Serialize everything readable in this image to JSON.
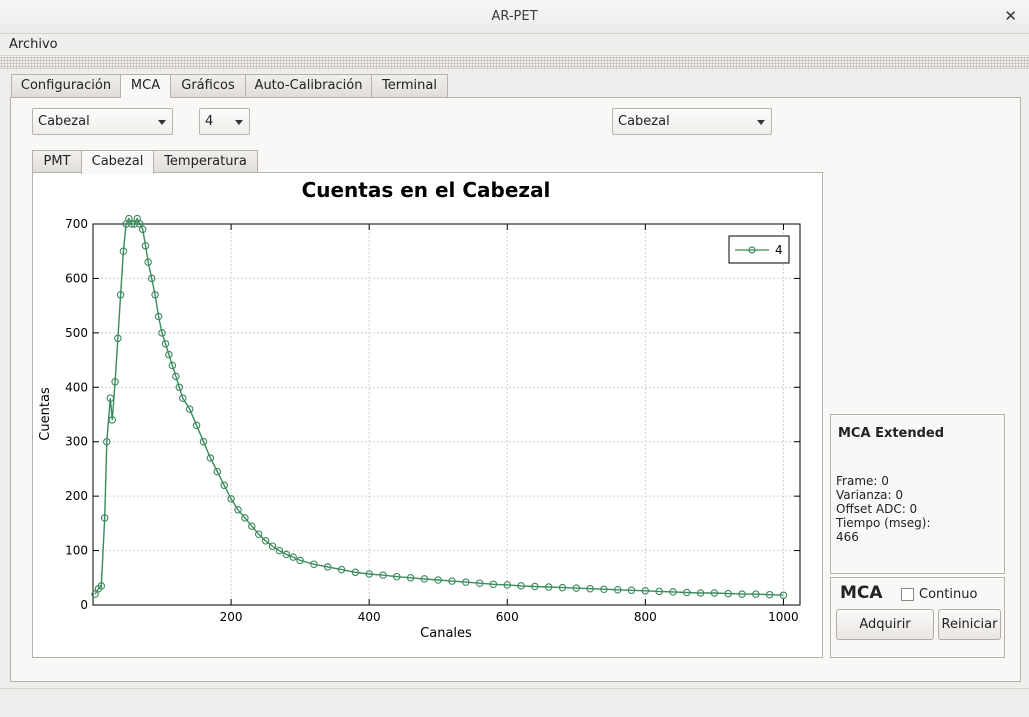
{
  "window": {
    "title": "AR-PET",
    "close_glyph": "✕"
  },
  "menubar": {
    "items": [
      "Archivo"
    ]
  },
  "main_tabs": [
    "Configuración",
    "MCA",
    "Gráficos",
    "Auto-Calibración",
    "Terminal"
  ],
  "controls": {
    "combo_left": "Cabezal",
    "combo_num": "4",
    "combo_right": "Cabezal"
  },
  "sub_tabs": [
    "PMT",
    "Cabezal",
    "Temperatura"
  ],
  "chart_data": {
    "type": "line",
    "title": "Cuentas en el Cabezal",
    "xlabel": "Canales",
    "ylabel": "Cuentas",
    "xlim": [
      0,
      1024
    ],
    "ylim": [
      0,
      700
    ],
    "xticks": [
      200,
      400,
      600,
      800,
      1000
    ],
    "yticks": [
      0,
      100,
      200,
      300,
      400,
      500,
      600,
      700
    ],
    "grid": true,
    "legend_position": "top-right",
    "marker": "circle",
    "series_color": "#3a8a5c",
    "series": [
      {
        "name": "4",
        "x": [
          3,
          8,
          12,
          17,
          20,
          25,
          28,
          32,
          36,
          40,
          44,
          48,
          52,
          56,
          60,
          64,
          68,
          72,
          76,
          80,
          85,
          90,
          95,
          100,
          105,
          110,
          115,
          120,
          125,
          130,
          140,
          150,
          160,
          170,
          180,
          190,
          200,
          210,
          220,
          230,
          240,
          250,
          260,
          270,
          280,
          290,
          300,
          320,
          340,
          360,
          380,
          400,
          420,
          440,
          460,
          480,
          500,
          520,
          540,
          560,
          580,
          600,
          620,
          640,
          660,
          680,
          700,
          720,
          740,
          760,
          780,
          800,
          820,
          840,
          860,
          880,
          900,
          920,
          940,
          960,
          980,
          1000
        ],
        "values": [
          20,
          30,
          35,
          160,
          300,
          380,
          340,
          410,
          490,
          570,
          650,
          700,
          710,
          700,
          700,
          710,
          700,
          690,
          660,
          630,
          600,
          570,
          530,
          500,
          480,
          460,
          440,
          420,
          400,
          380,
          360,
          330,
          300,
          270,
          245,
          220,
          195,
          175,
          160,
          145,
          130,
          118,
          108,
          100,
          93,
          88,
          82,
          75,
          70,
          65,
          60,
          57,
          55,
          52,
          50,
          48,
          46,
          44,
          42,
          40,
          38,
          37,
          35,
          34,
          33,
          32,
          31,
          30,
          29,
          28,
          27,
          26,
          25,
          24,
          23,
          22,
          22,
          21,
          20,
          20,
          19,
          18
        ]
      }
    ]
  },
  "mca_extended": {
    "title": "MCA Extended",
    "frame": "Frame: 0",
    "varianza": "Varianza: 0",
    "offset_adc": "Offset ADC: 0",
    "tiempo_label": "Tiempo (mseg):",
    "tiempo_value": "466"
  },
  "mca_box": {
    "title": "MCA",
    "continuo_label": "Continuo",
    "continuo_checked": false,
    "adquirir_label": "Adquirir",
    "reiniciar_label": "Reiniciar"
  }
}
